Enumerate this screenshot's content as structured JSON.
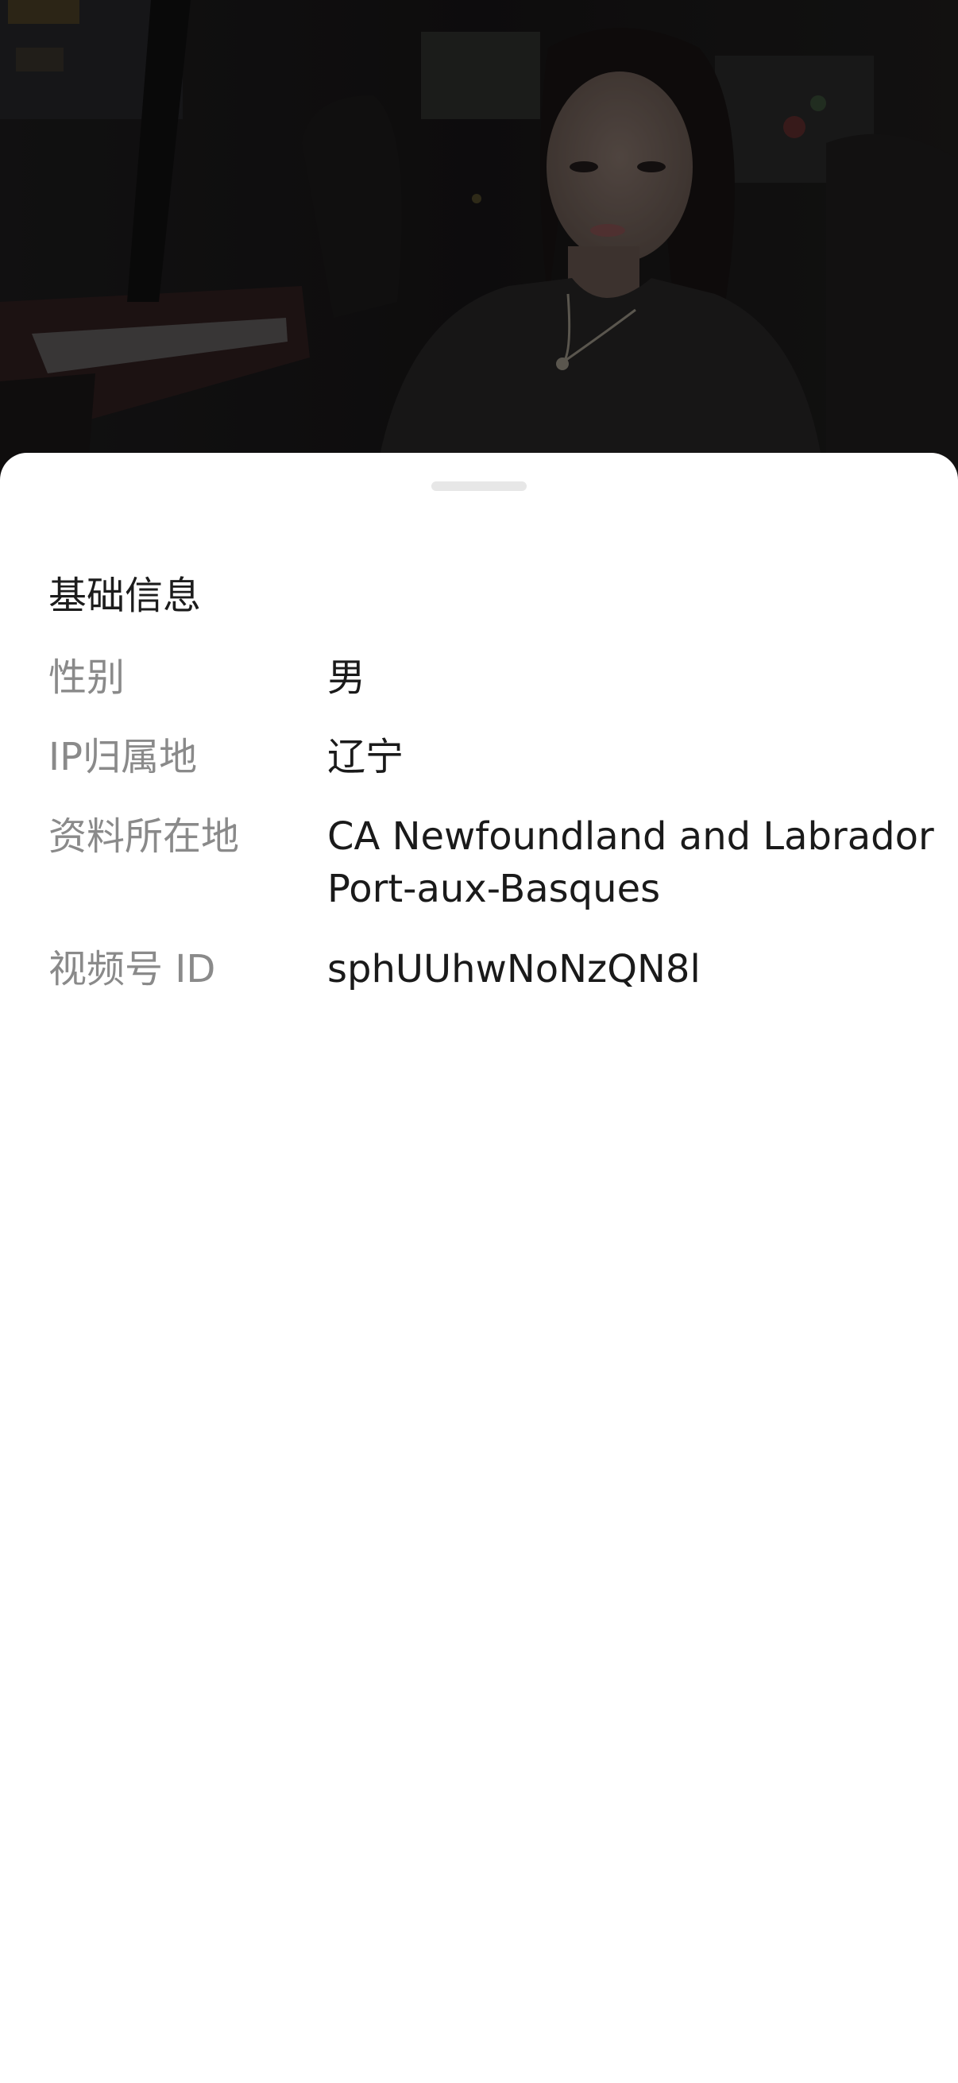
{
  "basic_info": {
    "title": "基础信息",
    "rows": [
      {
        "label": "性别",
        "value": "男"
      },
      {
        "label": "IP归属地",
        "value": "辽宁"
      },
      {
        "label": "资料所在地",
        "value_line1": "CA Newfoundland and Labrador",
        "value_line2": "Port-aux-Basques"
      },
      {
        "label": "视频号 ID",
        "value": "sphUUhwNoNzQN8l"
      }
    ]
  },
  "colors": {
    "overlay": "#000000",
    "sheet_background": "#ffffff",
    "label_text": "#8a8a8a",
    "value_text": "#1a1a1a",
    "grabber": "#e7e7e7"
  },
  "icons": {
    "background_photo": "profile-photo",
    "sheet_handle": "drag-handle"
  }
}
